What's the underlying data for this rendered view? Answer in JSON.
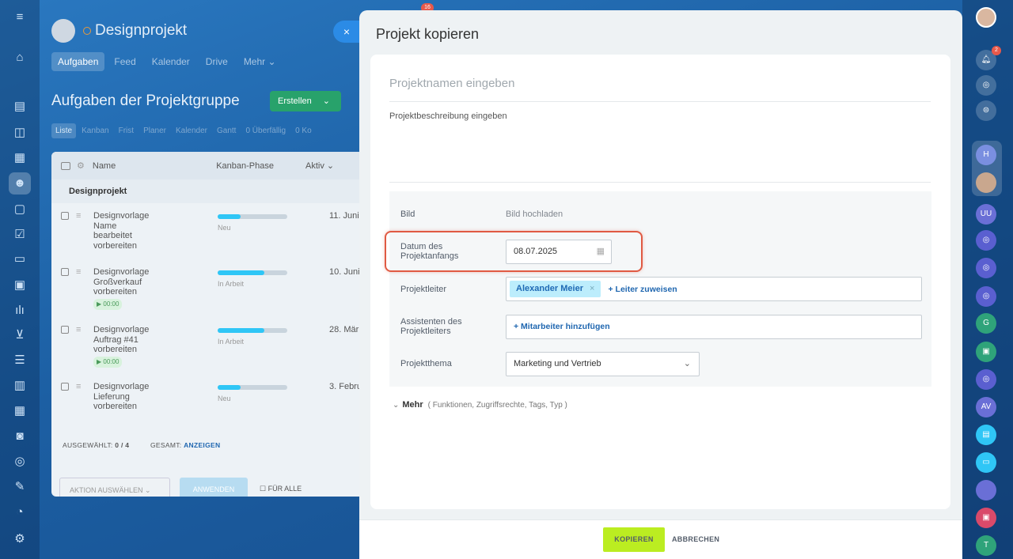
{
  "top_badge": "16",
  "project_panel": {
    "title": "Designprojekt",
    "tabs": [
      "Aufgaben",
      "Feed",
      "Kalender",
      "Drive",
      "Mehr ⌄"
    ],
    "heading": "Aufgaben der Projektgruppe",
    "create_label": "Erstellen",
    "views": [
      "Liste",
      "Kanban",
      "Frist",
      "Planer",
      "Kalender",
      "Gantt",
      "0 Überfällig",
      "0 Ko"
    ],
    "columns": {
      "name": "Name",
      "phase": "Kanban-Phase",
      "active": "Aktiv ⌄"
    },
    "group": "Designprojekt",
    "rows": [
      {
        "name": "Designvorlage Name bearbeitet vorbereiten",
        "status": "Neu",
        "date": "11. Juni,",
        "progress": 0.33,
        "timer": ""
      },
      {
        "name": "Designvorlage Großverkauf vorbereiten",
        "status": "In Arbeit",
        "date": "10. Juni",
        "progress": 0.67,
        "timer": "▶ 00:00"
      },
      {
        "name": "Designvorlage Auftrag #41 vorbereiten",
        "status": "In Arbeit",
        "date": "28. Mär",
        "progress": 0.67,
        "timer": "▶ 00:00"
      },
      {
        "name": "Designvorlage Lieferung vorbereiten",
        "status": "Neu",
        "date": "3. Febru",
        "progress": 0.33,
        "timer": ""
      }
    ],
    "selected_label": "AUSGEWÄHLT:",
    "selected_value": "0 / 4",
    "total_label": "GESAMT:",
    "total_link": "ANZEIGEN",
    "action_select": "AKTION AUSWÄHLEN",
    "apply": "ANWENDEN",
    "for_all": "FÜR ALLE"
  },
  "close_icon": "×",
  "dialog": {
    "title": "Projekt kopieren",
    "name_placeholder": "Projektnamen eingeben",
    "desc_placeholder": "Projektbeschreibung eingeben",
    "image_label": "Bild",
    "image_link": "Bild hochladen",
    "start_label": "Datum des Projektanfangs",
    "start_value": "08.07.2025",
    "leader_label": "Projektleiter",
    "leader_tag": "Alexander Meier",
    "leader_assign": "+ Leiter zuweisen",
    "assistants_label": "Assistenten des Projektleiters",
    "assistants_add": "+ Mitarbeiter hinzufügen",
    "theme_label": "Projektthema",
    "theme_value": "Marketing und Vertrieb",
    "more_label": "Mehr",
    "more_hint": "( Funktionen, Zugriffsrechte, Tags, Typ )",
    "copy_button": "KOPIEREN",
    "cancel_button": "ABBRECHEN"
  },
  "right_rail": {
    "notification_count": "2",
    "avatars": [
      "H",
      "UU",
      "G",
      "AV",
      "T"
    ]
  },
  "colors": {
    "accent": "#2fc6f6",
    "copy_button": "#bbed21",
    "highlight": "#e05a43",
    "create": "#28a26b"
  }
}
